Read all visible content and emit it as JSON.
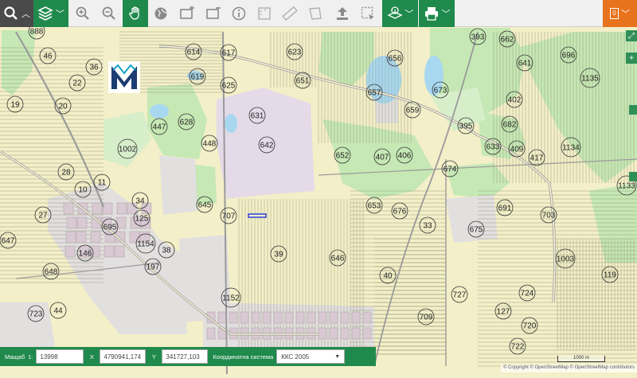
{
  "toolbar": {
    "print_label": "Печат",
    "notification_count": "0"
  },
  "status": {
    "scale_label": "Мащаб",
    "scale_prefix": "1:",
    "scale_value": "13998",
    "x_label": "X",
    "x_value": "4790941,174",
    "y_label": "Y",
    "y_value": "341727,103",
    "crs_label": "Координатна система",
    "crs_value": "ККС 2005"
  },
  "map": {
    "attribution": "© Copyright © OpenStreetMap © OpenStreetMap contributors",
    "scale_text": "1000 m",
    "parcel_numbers": [
      "888",
      "46",
      "36",
      "614",
      "617",
      "623",
      "656",
      "393",
      "662",
      "696",
      "641",
      "1135",
      "19",
      "22",
      "619",
      "625",
      "651",
      "657",
      "673",
      "402",
      "20",
      "447",
      "628",
      "631",
      "659",
      "395",
      "682",
      "633",
      "409",
      "1134",
      "448",
      "642",
      "652",
      "407",
      "406",
      "674",
      "417",
      "1002",
      "28",
      "10",
      "11",
      "645",
      "707",
      "653",
      "676",
      "691",
      "703",
      "1133",
      "27",
      "34",
      "125",
      "33",
      "675",
      "695",
      "1003",
      "1154",
      "38",
      "39",
      "646",
      "647",
      "146",
      "197",
      "40",
      "648",
      "119",
      "1152",
      "709",
      "727",
      "724",
      "723",
      "44",
      "127",
      "720",
      "722",
      "424"
    ]
  },
  "colors": {
    "toolbar_green": "#1f8a4c",
    "toolbar_dark": "#4a4a4a",
    "toolbar_orange": "#e8731d",
    "land_yellow": "#f3efc8",
    "forest_green": "#c5e8b4",
    "urban_gray": "#e2dfdf"
  }
}
